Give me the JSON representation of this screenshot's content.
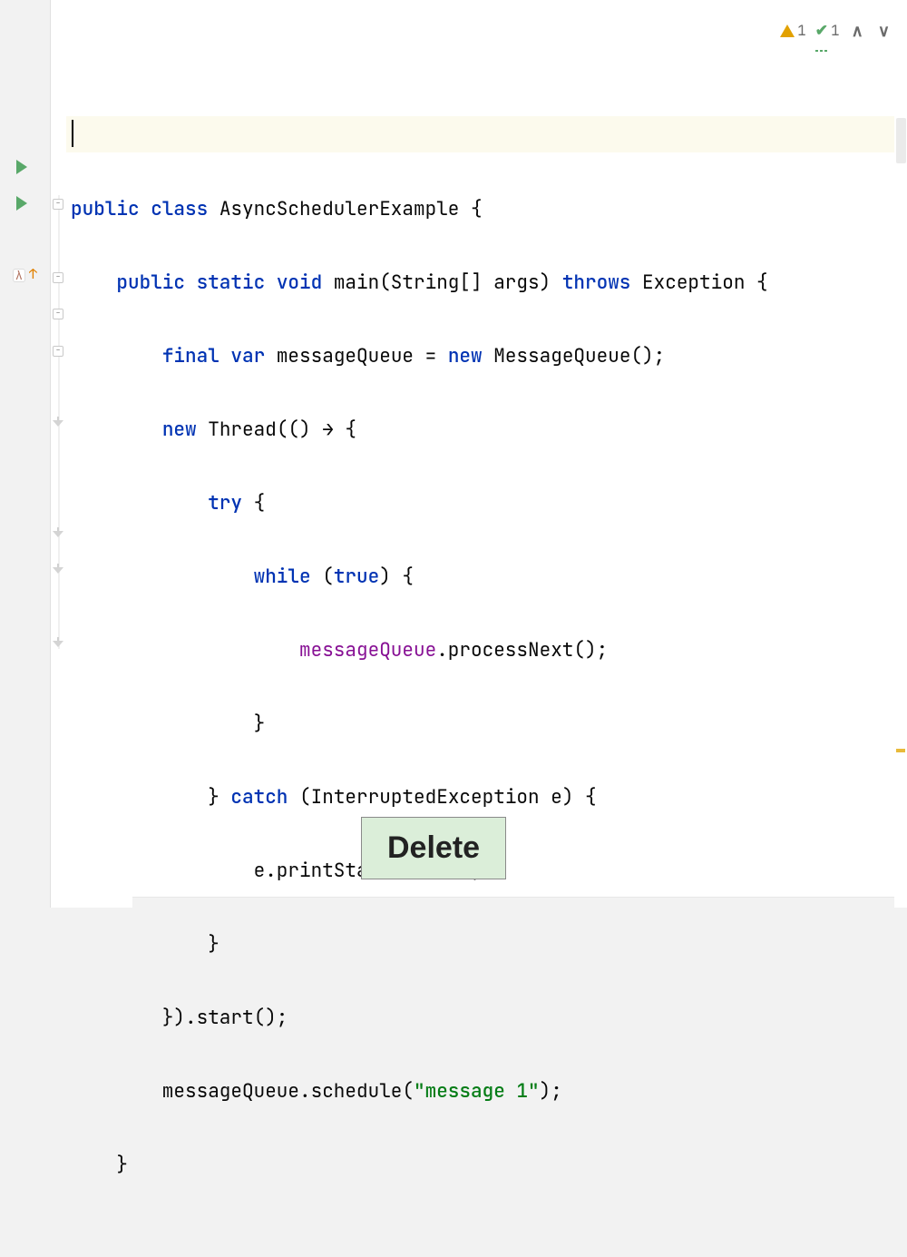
{
  "inspections": {
    "warning_count": "1",
    "typo_count": "1"
  },
  "button_label": "Delete",
  "code": {
    "l1": {
      "t1": "public ",
      "t2": "class ",
      "t3": "AsyncSchedulerExample {"
    },
    "l2": {
      "t1": "    ",
      "t2": "public ",
      "t3": "static ",
      "t4": "void ",
      "t5": "main(String[] args) ",
      "t6": "throws ",
      "t7": "Exception {"
    },
    "l3": {
      "t1": "        ",
      "t2": "final ",
      "t3": "var ",
      "t4": "messageQueue = ",
      "t5": "new ",
      "t6": "MessageQueue();"
    },
    "l4": {
      "t1": "        ",
      "t2": "new ",
      "t3": "Thread(() → {"
    },
    "l5": {
      "t1": "            ",
      "t2": "try ",
      "t3": "{"
    },
    "l6": {
      "t1": "                ",
      "t2": "while ",
      "t3": "(",
      "t4": "true",
      "t5": ") {"
    },
    "l7": {
      "t1": "                    ",
      "t2": "messageQueue",
      "t3": ".processNext();"
    },
    "l8": {
      "t1": "                }"
    },
    "l9": {
      "t1": "            } ",
      "t2": "catch ",
      "t3": "(InterruptedException e) {"
    },
    "l10": {
      "t1": "                e.printStackTrace();"
    },
    "l11": {
      "t1": "            }"
    },
    "l12": {
      "t1": "        }).start();"
    },
    "l13": {
      "t1": "        messageQueue.schedule(",
      "t2": "\"message 1\"",
      "t3": ");"
    },
    "l14": {
      "t1": "    }"
    }
  }
}
